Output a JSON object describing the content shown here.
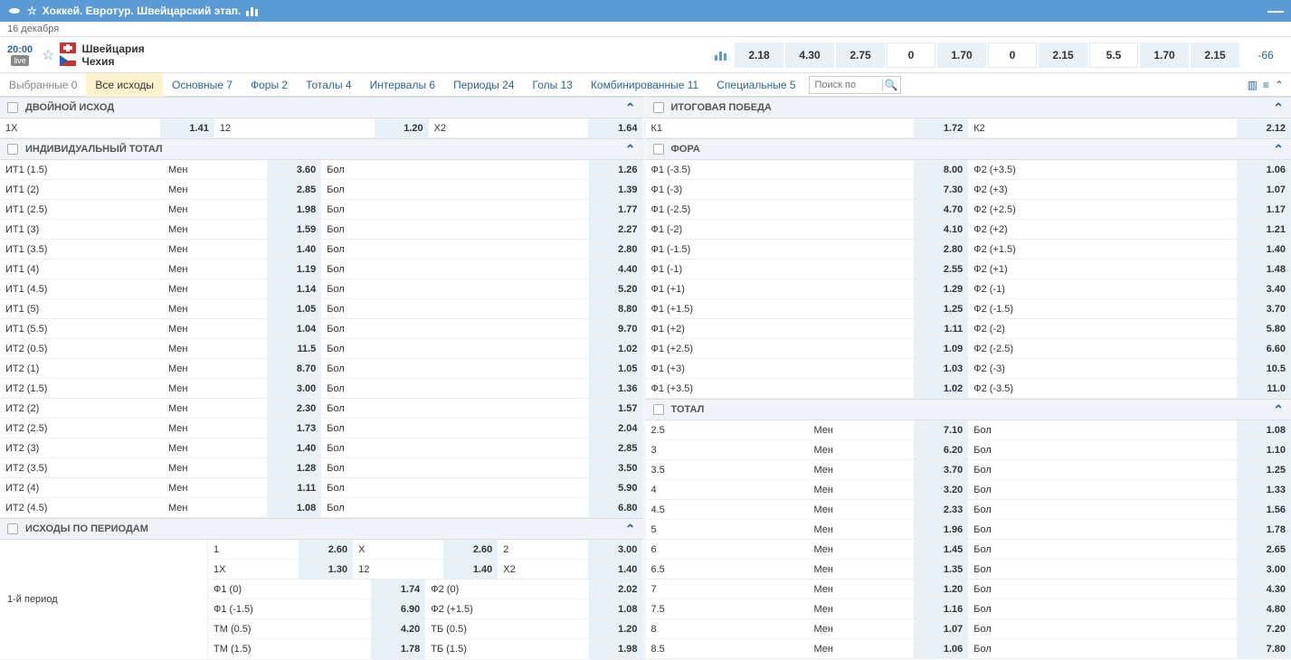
{
  "header": {
    "title": "Хоккей. Евротур. Швейцарский этап."
  },
  "date": "16 декабря",
  "match": {
    "time": "20:00",
    "live": "live",
    "team1": "Швейцария",
    "team2": "Чехия"
  },
  "strip": {
    "odds": [
      "2.18",
      "4.30",
      "2.75",
      "0",
      "1.70",
      "0",
      "2.15",
      "5.5",
      "1.70",
      "2.15"
    ],
    "tail": "-66"
  },
  "filters": {
    "selected": "Выбранные 0",
    "tabs": [
      {
        "label": "Все исходы",
        "active": true
      },
      {
        "label": "Основные 7"
      },
      {
        "label": "Форы 2"
      },
      {
        "label": "Тоталы 4"
      },
      {
        "label": "Интервалы 6"
      },
      {
        "label": "Периоды 24"
      },
      {
        "label": "Голы 13"
      },
      {
        "label": "Комбинированные 11"
      },
      {
        "label": "Специальные 5"
      }
    ],
    "search_ph": "Поиск по"
  },
  "left": {
    "double": {
      "title": "ДВОЙНОЙ ИСХОД",
      "row": [
        [
          "1X",
          "1.41"
        ],
        [
          "12",
          "1.20"
        ],
        [
          "X2",
          "1.64"
        ]
      ]
    },
    "ind_total": {
      "title": "ИНДИВИДУАЛЬНЫЙ ТОТАЛ",
      "under": "Мен",
      "over": "Бол",
      "rows": [
        [
          "ИТ1 (1.5)",
          "3.60",
          "1.26"
        ],
        [
          "ИТ1 (2)",
          "2.85",
          "1.39"
        ],
        [
          "ИТ1 (2.5)",
          "1.98",
          "1.77"
        ],
        [
          "ИТ1 (3)",
          "1.59",
          "2.27"
        ],
        [
          "ИТ1 (3.5)",
          "1.40",
          "2.80"
        ],
        [
          "ИТ1 (4)",
          "1.19",
          "4.40"
        ],
        [
          "ИТ1 (4.5)",
          "1.14",
          "5.20"
        ],
        [
          "ИТ1 (5)",
          "1.05",
          "8.80"
        ],
        [
          "ИТ1 (5.5)",
          "1.04",
          "9.70"
        ],
        [
          "ИТ2 (0.5)",
          "11.5",
          "1.02"
        ],
        [
          "ИТ2 (1)",
          "8.70",
          "1.05"
        ],
        [
          "ИТ2 (1.5)",
          "3.00",
          "1.36"
        ],
        [
          "ИТ2 (2)",
          "2.30",
          "1.57"
        ],
        [
          "ИТ2 (2.5)",
          "1.73",
          "2.04"
        ],
        [
          "ИТ2 (3)",
          "1.40",
          "2.85"
        ],
        [
          "ИТ2 (3.5)",
          "1.28",
          "3.50"
        ],
        [
          "ИТ2 (4)",
          "1.11",
          "5.90"
        ],
        [
          "ИТ2 (4.5)",
          "1.08",
          "6.80"
        ]
      ]
    },
    "periods": {
      "title": "ИСХОДЫ ПО ПЕРИОДАМ",
      "period_label": "1-й период",
      "row1": [
        [
          "1",
          "2.60"
        ],
        [
          "X",
          "2.60"
        ],
        [
          "2",
          "3.00"
        ]
      ],
      "row2": [
        [
          "1X",
          "1.30"
        ],
        [
          "12",
          "1.40"
        ],
        [
          "X2",
          "1.40"
        ]
      ],
      "row3": [
        [
          "Ф1 (0)",
          "1.74"
        ],
        [
          "Ф2 (0)",
          "2.02"
        ]
      ],
      "row4": [
        [
          "Ф1 (-1.5)",
          "6.90"
        ],
        [
          "Ф2 (+1.5)",
          "1.08"
        ]
      ],
      "row5": [
        [
          "ТМ (0.5)",
          "4.20"
        ],
        [
          "ТБ (0.5)",
          "1.20"
        ]
      ],
      "row6": [
        [
          "ТМ (1.5)",
          "1.78"
        ],
        [
          "ТБ (1.5)",
          "1.98"
        ]
      ]
    }
  },
  "right": {
    "final": {
      "title": "ИТОГОВАЯ ПОБЕДА",
      "row": [
        [
          "К1",
          "1.72"
        ],
        [
          "К2",
          "2.12"
        ]
      ]
    },
    "fora": {
      "title": "ФОРА",
      "rows": [
        [
          [
            "Ф1 (-3.5)",
            "8.00"
          ],
          [
            "Ф2 (+3.5)",
            "1.06"
          ]
        ],
        [
          [
            "Ф1 (-3)",
            "7.30"
          ],
          [
            "Ф2 (+3)",
            "1.07"
          ]
        ],
        [
          [
            "Ф1 (-2.5)",
            "4.70"
          ],
          [
            "Ф2 (+2.5)",
            "1.17"
          ]
        ],
        [
          [
            "Ф1 (-2)",
            "4.10"
          ],
          [
            "Ф2 (+2)",
            "1.21"
          ]
        ],
        [
          [
            "Ф1 (-1.5)",
            "2.80"
          ],
          [
            "Ф2 (+1.5)",
            "1.40"
          ]
        ],
        [
          [
            "Ф1 (-1)",
            "2.55"
          ],
          [
            "Ф2 (+1)",
            "1.48"
          ]
        ],
        [
          [
            "Ф1 (+1)",
            "1.29"
          ],
          [
            "Ф2 (-1)",
            "3.40"
          ]
        ],
        [
          [
            "Ф1 (+1.5)",
            "1.25"
          ],
          [
            "Ф2 (-1.5)",
            "3.70"
          ]
        ],
        [
          [
            "Ф1 (+2)",
            "1.11"
          ],
          [
            "Ф2 (-2)",
            "5.80"
          ]
        ],
        [
          [
            "Ф1 (+2.5)",
            "1.09"
          ],
          [
            "Ф2 (-2.5)",
            "6.60"
          ]
        ],
        [
          [
            "Ф1 (+3)",
            "1.03"
          ],
          [
            "Ф2 (-3)",
            "10.5"
          ]
        ],
        [
          [
            "Ф1 (+3.5)",
            "1.02"
          ],
          [
            "Ф2 (-3.5)",
            "11.0"
          ]
        ]
      ]
    },
    "total": {
      "title": "ТОТАЛ",
      "under": "Мен",
      "over": "Бол",
      "rows": [
        [
          "2.5",
          "7.10",
          "1.08"
        ],
        [
          "3",
          "6.20",
          "1.10"
        ],
        [
          "3.5",
          "3.70",
          "1.25"
        ],
        [
          "4",
          "3.20",
          "1.33"
        ],
        [
          "4.5",
          "2.33",
          "1.56"
        ],
        [
          "5",
          "1.96",
          "1.78"
        ],
        [
          "6",
          "1.45",
          "2.65"
        ],
        [
          "6.5",
          "1.35",
          "3.00"
        ],
        [
          "7",
          "1.20",
          "4.30"
        ],
        [
          "7.5",
          "1.16",
          "4.80"
        ],
        [
          "8",
          "1.07",
          "7.20"
        ],
        [
          "8.5",
          "1.06",
          "7.80"
        ]
      ]
    }
  }
}
